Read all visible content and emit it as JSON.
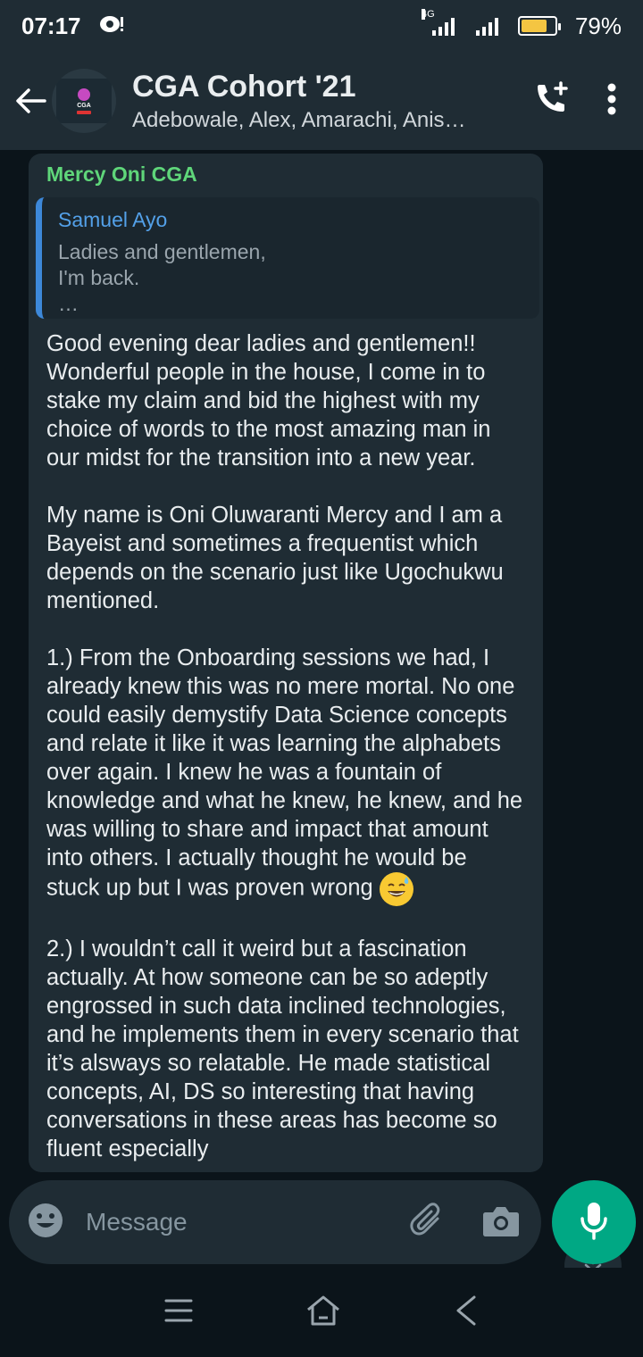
{
  "status_bar": {
    "time": "07:17",
    "network": "4G",
    "battery_percent": "79%",
    "battery_level": 0.79
  },
  "header": {
    "title": "CGA Cohort '21",
    "subtitle": "Adebowale, Alex, Amarachi, Anis…",
    "icons": [
      "back-arrow-icon",
      "add-call-icon",
      "more-vert-icon"
    ]
  },
  "message": {
    "sender": "Mercy Oni CGA",
    "quoted": {
      "author": "Samuel Ayo",
      "text": "Ladies and gentlemen,\nI'm back.\n…"
    },
    "body_part1": "Good evening dear ladies and gentlemen!!\nWonderful people in the house, I come in to stake my claim and bid the highest with my choice of words to the most amazing man in our midst for the transition into a new year.\n\nMy name is Oni Oluwaranti Mercy and I am a Bayeist and sometimes a frequentist which depends on the scenario just like Ugochukwu mentioned.\n\n1.) From the Onboarding sessions we had, I already knew this was no mere mortal. No one could easily demystify Data Science concepts and relate it like it was learning the alphabets over again. I knew he was a fountain of knowledge and what he knew, he knew, and he was willing to share and impact that amount into others. I actually thought he would be stuck up but I was proven wrong",
    "emoji": "grinning-sweat-emoji",
    "body_part2": "\n\n2.) I wouldn’t call it weird but a fascination actually. At how someone can be so adeptly engrossed in such data inclined technologies, and he implements them in every scenario that it’s alsways so relatable. He made statistical concepts, AI, DS so interesting that having conversations in these areas has become so fluent especially"
  },
  "input": {
    "placeholder": "Message"
  },
  "colors": {
    "header_bg": "#1f2c34",
    "chat_bg": "#0b141a",
    "bubble_bg": "#1f2c34",
    "sender_name": "#5fd67a",
    "quote_bar": "#3d88d9",
    "mic_button": "#00a884",
    "battery": "#f4c542"
  }
}
